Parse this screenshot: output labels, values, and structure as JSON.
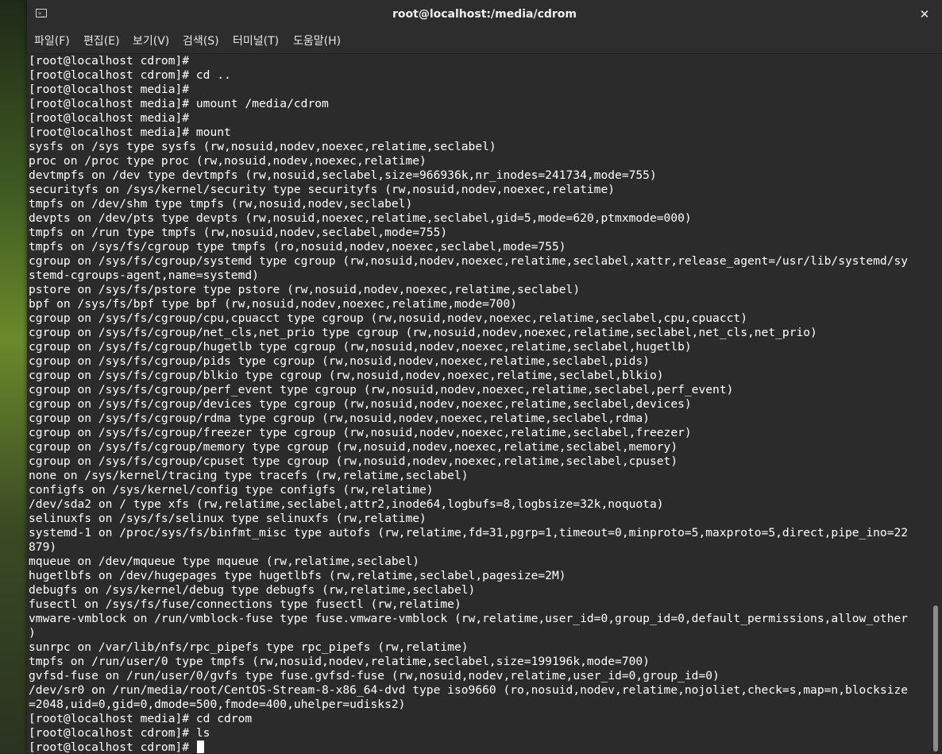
{
  "window": {
    "title": "root@localhost:/media/cdrom",
    "close_glyph": "✕",
    "icon": "terminal-icon"
  },
  "menu": [
    {
      "label": "파일(F)"
    },
    {
      "label": "편집(E)"
    },
    {
      "label": "보기(V)"
    },
    {
      "label": "검색(S)"
    },
    {
      "label": "터미널(T)"
    },
    {
      "label": "도움말(H)"
    }
  ],
  "terminal": {
    "lines": [
      "[root@localhost cdrom]#",
      "[root@localhost cdrom]# cd ..",
      "[root@localhost media]#",
      "[root@localhost media]# umount /media/cdrom",
      "[root@localhost media]#",
      "[root@localhost media]# mount",
      "sysfs on /sys type sysfs (rw,nosuid,nodev,noexec,relatime,seclabel)",
      "proc on /proc type proc (rw,nosuid,nodev,noexec,relatime)",
      "devtmpfs on /dev type devtmpfs (rw,nosuid,seclabel,size=966936k,nr_inodes=241734,mode=755)",
      "securityfs on /sys/kernel/security type securityfs (rw,nosuid,nodev,noexec,relatime)",
      "tmpfs on /dev/shm type tmpfs (rw,nosuid,nodev,seclabel)",
      "devpts on /dev/pts type devpts (rw,nosuid,noexec,relatime,seclabel,gid=5,mode=620,ptmxmode=000)",
      "tmpfs on /run type tmpfs (rw,nosuid,nodev,seclabel,mode=755)",
      "tmpfs on /sys/fs/cgroup type tmpfs (ro,nosuid,nodev,noexec,seclabel,mode=755)",
      "cgroup on /sys/fs/cgroup/systemd type cgroup (rw,nosuid,nodev,noexec,relatime,seclabel,xattr,release_agent=/usr/lib/systemd/sy",
      "stemd-cgroups-agent,name=systemd)",
      "pstore on /sys/fs/pstore type pstore (rw,nosuid,nodev,noexec,relatime,seclabel)",
      "bpf on /sys/fs/bpf type bpf (rw,nosuid,nodev,noexec,relatime,mode=700)",
      "cgroup on /sys/fs/cgroup/cpu,cpuacct type cgroup (rw,nosuid,nodev,noexec,relatime,seclabel,cpu,cpuacct)",
      "cgroup on /sys/fs/cgroup/net_cls,net_prio type cgroup (rw,nosuid,nodev,noexec,relatime,seclabel,net_cls,net_prio)",
      "cgroup on /sys/fs/cgroup/hugetlb type cgroup (rw,nosuid,nodev,noexec,relatime,seclabel,hugetlb)",
      "cgroup on /sys/fs/cgroup/pids type cgroup (rw,nosuid,nodev,noexec,relatime,seclabel,pids)",
      "cgroup on /sys/fs/cgroup/blkio type cgroup (rw,nosuid,nodev,noexec,relatime,seclabel,blkio)",
      "cgroup on /sys/fs/cgroup/perf_event type cgroup (rw,nosuid,nodev,noexec,relatime,seclabel,perf_event)",
      "cgroup on /sys/fs/cgroup/devices type cgroup (rw,nosuid,nodev,noexec,relatime,seclabel,devices)",
      "cgroup on /sys/fs/cgroup/rdma type cgroup (rw,nosuid,nodev,noexec,relatime,seclabel,rdma)",
      "cgroup on /sys/fs/cgroup/freezer type cgroup (rw,nosuid,nodev,noexec,relatime,seclabel,freezer)",
      "cgroup on /sys/fs/cgroup/memory type cgroup (rw,nosuid,nodev,noexec,relatime,seclabel,memory)",
      "cgroup on /sys/fs/cgroup/cpuset type cgroup (rw,nosuid,nodev,noexec,relatime,seclabel,cpuset)",
      "none on /sys/kernel/tracing type tracefs (rw,relatime,seclabel)",
      "configfs on /sys/kernel/config type configfs (rw,relatime)",
      "/dev/sda2 on / type xfs (rw,relatime,seclabel,attr2,inode64,logbufs=8,logbsize=32k,noquota)",
      "selinuxfs on /sys/fs/selinux type selinuxfs (rw,relatime)",
      "systemd-1 on /proc/sys/fs/binfmt_misc type autofs (rw,relatime,fd=31,pgrp=1,timeout=0,minproto=5,maxproto=5,direct,pipe_ino=22",
      "879)",
      "mqueue on /dev/mqueue type mqueue (rw,relatime,seclabel)",
      "hugetlbfs on /dev/hugepages type hugetlbfs (rw,relatime,seclabel,pagesize=2M)",
      "debugfs on /sys/kernel/debug type debugfs (rw,relatime,seclabel)",
      "fusectl on /sys/fs/fuse/connections type fusectl (rw,relatime)",
      "vmware-vmblock on /run/vmblock-fuse type fuse.vmware-vmblock (rw,relatime,user_id=0,group_id=0,default_permissions,allow_other",
      ")",
      "sunrpc on /var/lib/nfs/rpc_pipefs type rpc_pipefs (rw,relatime)",
      "tmpfs on /run/user/0 type tmpfs (rw,nosuid,nodev,relatime,seclabel,size=199196k,mode=700)",
      "gvfsd-fuse on /run/user/0/gvfs type fuse.gvfsd-fuse (rw,nosuid,nodev,relatime,user_id=0,group_id=0)",
      "/dev/sr0 on /run/media/root/CentOS-Stream-8-x86_64-dvd type iso9660 (ro,nosuid,nodev,relatime,nojoliet,check=s,map=n,blocksize",
      "=2048,uid=0,gid=0,dmode=500,fmode=400,uhelper=udisks2)",
      "[root@localhost media]# cd cdrom",
      "[root@localhost cdrom]# ls",
      "[root@localhost cdrom]# "
    ]
  }
}
